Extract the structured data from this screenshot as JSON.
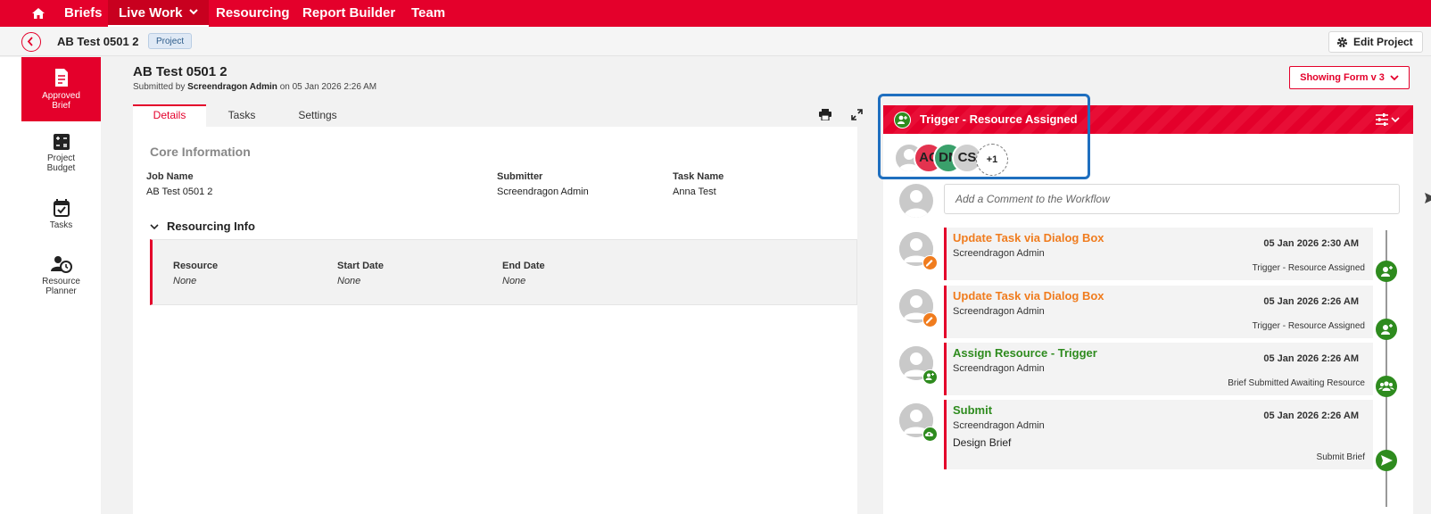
{
  "colors": {
    "brand": "#e4002b",
    "success": "#2e8b1e",
    "warning": "#f07c1e",
    "highlight": "#1f6fbf"
  },
  "nav": {
    "home_icon": "home-icon",
    "items": [
      {
        "label": "Briefs"
      },
      {
        "label": "Live Work",
        "active": true
      },
      {
        "label": "Resourcing"
      },
      {
        "label": "Report Builder"
      },
      {
        "label": "Team"
      }
    ]
  },
  "subheader": {
    "title": "AB Test 0501 2",
    "badge": "Project",
    "edit_label": "Edit Project"
  },
  "rail": [
    {
      "label_line1": "Approved",
      "label_line2": "Brief",
      "icon": "document-list-icon",
      "active": true
    },
    {
      "label_line1": "Project",
      "label_line2": "Budget",
      "icon": "calculator-icon"
    },
    {
      "label_line1": "Tasks",
      "label_line2": "",
      "icon": "calendar-check-icon"
    },
    {
      "label_line1": "Resource",
      "label_line2": "Planner",
      "icon": "person-clock-icon"
    }
  ],
  "doc": {
    "title": "AB Test 0501 2",
    "submitted_prefix": "Submitted by",
    "submitted_by": "Screendragon Admin",
    "submitted_on": "on 05 Jan 2026 2:26 AM",
    "tabs": [
      {
        "label": "Details",
        "active": true
      },
      {
        "label": "Tasks"
      },
      {
        "label": "Settings"
      }
    ],
    "form_version": "Showing Form v 3"
  },
  "core": {
    "title": "Core Information",
    "fields": [
      {
        "label": "Job Name",
        "value": "AB Test 0501 2"
      },
      {
        "label": "Submitter",
        "value": "Screendragon Admin"
      },
      {
        "label": "Task Name",
        "value": "Anna Test"
      }
    ]
  },
  "resourcing": {
    "title": "Resourcing Info",
    "fields": [
      {
        "label": "Resource",
        "value": "None"
      },
      {
        "label": "Start Date",
        "value": "None"
      },
      {
        "label": "End Date",
        "value": "None"
      }
    ]
  },
  "workflow": {
    "header": "Trigger - Resource Assigned",
    "avatars": [
      "AC",
      "DN",
      "CS"
    ],
    "more": "+1",
    "comment_placeholder": "Add a Comment to the Workflow",
    "entries": [
      {
        "title": "Update Task via Dialog Box",
        "by": "Screendragon Admin",
        "date": "05 Jan 2026 2:30 AM",
        "trigger": "Trigger - Resource Assigned",
        "color": "#f07c1e",
        "extra": ""
      },
      {
        "title": "Update Task via Dialog Box",
        "by": "Screendragon Admin",
        "date": "05 Jan 2026 2:26 AM",
        "trigger": "Trigger - Resource Assigned",
        "color": "#f07c1e",
        "extra": ""
      },
      {
        "title": "Assign Resource - Trigger",
        "by": "Screendragon Admin",
        "date": "05 Jan 2026 2:26 AM",
        "trigger": "Brief Submitted Awaiting Resource",
        "color": "#2e8b1e",
        "extra": ""
      },
      {
        "title": "Submit",
        "by": "Screendragon Admin",
        "date": "05 Jan 2026 2:26 AM",
        "trigger": "Submit Brief",
        "color": "#2e8b1e",
        "extra": "Design Brief"
      }
    ]
  }
}
